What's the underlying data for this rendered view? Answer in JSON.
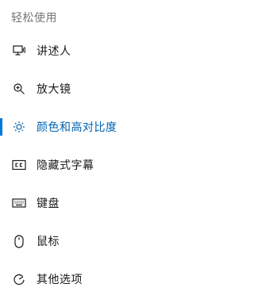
{
  "section_title": "轻松使用",
  "accent_color": "#0078d7",
  "nav": [
    {
      "label": "讲述人",
      "icon": "narrator-icon"
    },
    {
      "label": "放大镜",
      "icon": "magnifier-icon"
    },
    {
      "label": "颜色和高对比度",
      "icon": "brightness-icon",
      "active": true
    },
    {
      "label": "隐藏式字幕",
      "icon": "closed-captions-icon"
    },
    {
      "label": "键盘",
      "icon": "keyboard-icon"
    },
    {
      "label": "鼠标",
      "icon": "mouse-icon"
    },
    {
      "label": "其他选项",
      "icon": "other-options-icon"
    }
  ]
}
